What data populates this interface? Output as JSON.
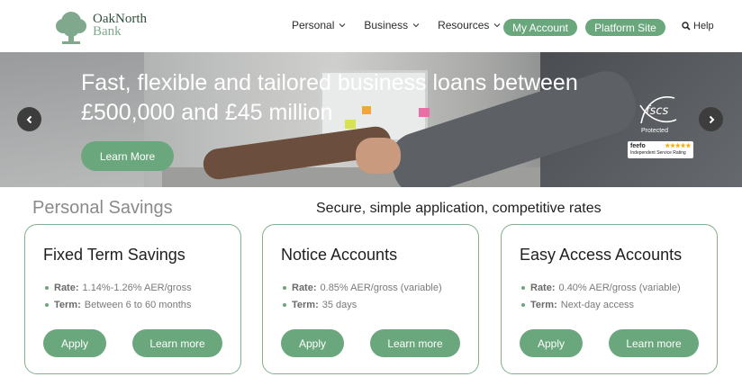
{
  "header": {
    "logo_line1": "OakNorth",
    "logo_line2": "Bank",
    "nav": [
      {
        "label": "Personal"
      },
      {
        "label": "Business"
      },
      {
        "label": "Resources"
      }
    ],
    "my_account": "My Account",
    "platform_site": "Platform Site",
    "help": "Help"
  },
  "hero": {
    "title": "Fast, flexible and tailored business loans between £500,000 and £45 million",
    "cta": "Learn More",
    "fscs_protected": "Protected",
    "feefo_brand": "feefo",
    "feefo_caption": "Independent Service Rating"
  },
  "section": {
    "title": "Personal Savings",
    "subtitle": "Secure, simple application, competitive rates"
  },
  "cards": [
    {
      "title": "Fixed Term Savings",
      "rate_label": "Rate:",
      "rate_value": "1.14%-1.26% AER/gross",
      "term_label": "Term:",
      "term_value": "Between 6 to 60 months",
      "apply": "Apply",
      "learn": "Learn more"
    },
    {
      "title": "Notice Accounts",
      "rate_label": "Rate:",
      "rate_value": "0.85% AER/gross (variable)",
      "term_label": "Term:",
      "term_value": "35 days",
      "apply": "Apply",
      "learn": "Learn more"
    },
    {
      "title": "Easy Access Accounts",
      "rate_label": "Rate:",
      "rate_value": "0.40% AER/gross (variable)",
      "term_label": "Term:",
      "term_value": "Next-day access",
      "apply": "Apply",
      "learn": "Learn more"
    }
  ],
  "icons": {
    "logo": "oak-tree-icon",
    "search": "search-icon",
    "chevron": "chevron-down-icon",
    "prev": "chevron-left-icon",
    "next": "chevron-right-icon"
  },
  "colors": {
    "brand_green": "#6aa77c",
    "card_border": "#7fb28d",
    "logo_dark": "#2f4f3a"
  }
}
